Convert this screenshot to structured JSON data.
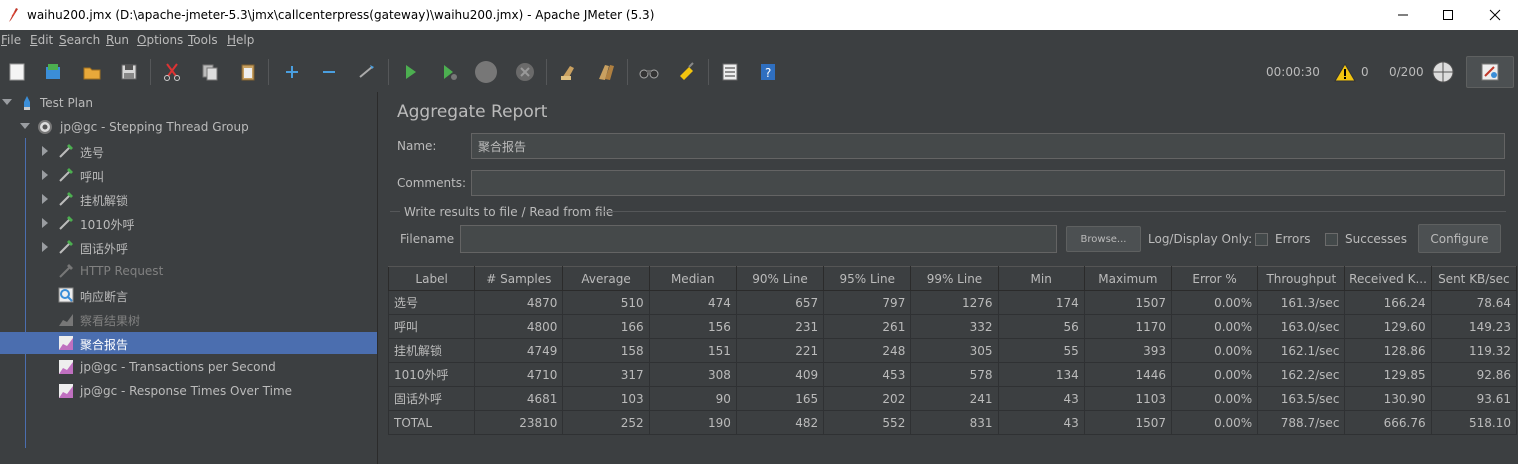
{
  "window": {
    "title": "waihu200.jmx (D:\\apache-jmeter-5.3\\jmx\\callcenterpress(gateway)\\waihu200.jmx) - Apache JMeter (5.3)"
  },
  "menu": {
    "items": [
      {
        "key": "F",
        "rest": "ile"
      },
      {
        "key": "E",
        "rest": "dit"
      },
      {
        "key": "S",
        "rest": "earch"
      },
      {
        "key": "R",
        "rest": "un"
      },
      {
        "key": "O",
        "rest": "ptions"
      },
      {
        "key": "T",
        "rest": "ools"
      },
      {
        "key": "H",
        "rest": "elp"
      }
    ]
  },
  "toolbar": {
    "elapsed": "00:00:30",
    "warnings": "0",
    "threads": "0/200"
  },
  "tree": {
    "test_plan": "Test Plan",
    "thread_group": "jp@gc - Stepping Thread Group",
    "nodes": [
      "选号",
      "呼叫",
      "挂机解锁",
      "1010外呼",
      "固话外呼",
      "HTTP Request",
      "响应断言",
      "察看结果树",
      "聚合报告",
      "jp@gc - Transactions per Second",
      "jp@gc - Response Times Over Time"
    ]
  },
  "panel": {
    "title": "Aggregate Report",
    "name_label": "Name:",
    "name_value": "聚合报告",
    "comments_label": "Comments:",
    "comments_value": "",
    "file_group": "Write results to file / Read from file",
    "filename_label": "Filename",
    "filename_value": "",
    "browse": "Browse...",
    "log_only": "Log/Display Only:",
    "errors": "Errors",
    "successes": "Successes",
    "configure": "Configure"
  },
  "table": {
    "headers": [
      "Label",
      "# Samples",
      "Average",
      "Median",
      "90% Line",
      "95% Line",
      "99% Line",
      "Min",
      "Maximum",
      "Error %",
      "Throughput",
      "Received K...",
      "Sent KB/sec"
    ],
    "rows": [
      [
        "选号",
        "4870",
        "510",
        "474",
        "657",
        "797",
        "1276",
        "174",
        "1507",
        "0.00%",
        "161.3/sec",
        "166.24",
        "78.64"
      ],
      [
        "呼叫",
        "4800",
        "166",
        "156",
        "231",
        "261",
        "332",
        "56",
        "1170",
        "0.00%",
        "163.0/sec",
        "129.60",
        "149.23"
      ],
      [
        "挂机解锁",
        "4749",
        "158",
        "151",
        "221",
        "248",
        "305",
        "55",
        "393",
        "0.00%",
        "162.1/sec",
        "128.86",
        "119.32"
      ],
      [
        "1010外呼",
        "4710",
        "317",
        "308",
        "409",
        "453",
        "578",
        "134",
        "1446",
        "0.00%",
        "162.2/sec",
        "129.85",
        "92.86"
      ],
      [
        "固话外呼",
        "4681",
        "103",
        "90",
        "165",
        "202",
        "241",
        "43",
        "1103",
        "0.00%",
        "163.5/sec",
        "130.90",
        "93.61"
      ],
      [
        "TOTAL",
        "23810",
        "252",
        "190",
        "482",
        "552",
        "831",
        "43",
        "1507",
        "0.00%",
        "788.7/sec",
        "666.76",
        "518.10"
      ]
    ]
  }
}
